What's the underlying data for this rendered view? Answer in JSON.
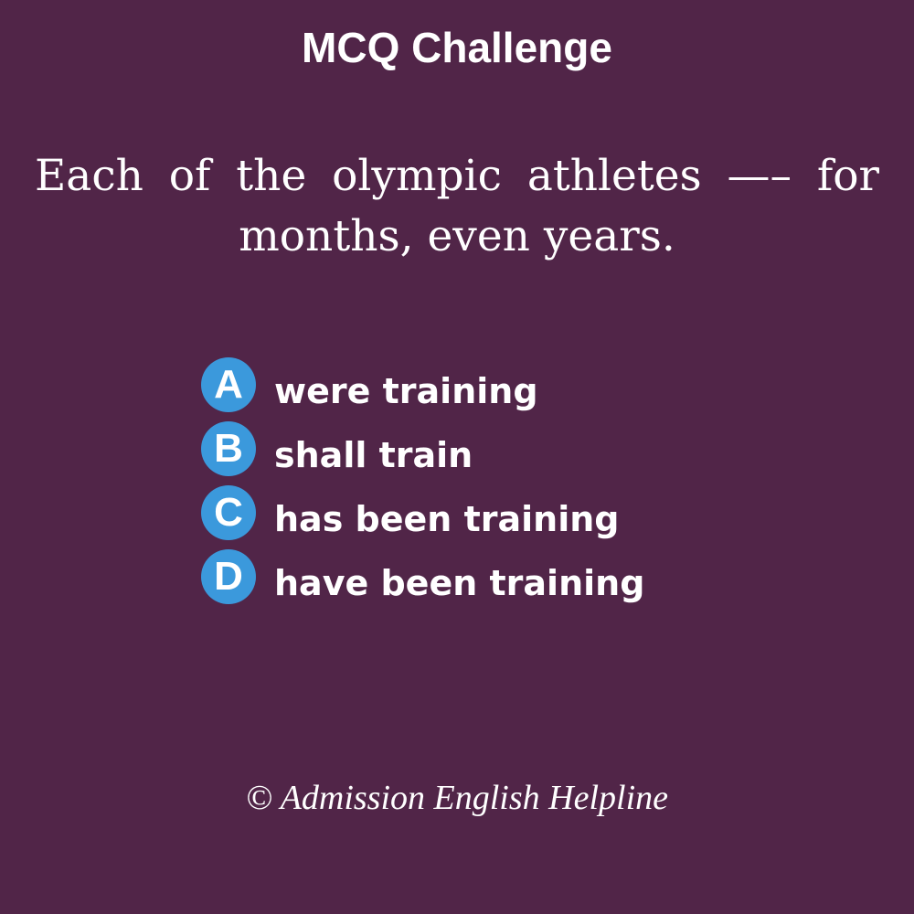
{
  "title": "MCQ Challenge",
  "question": "Each of the olympic athletes —– for months, even years.",
  "options": [
    {
      "letter": "A",
      "text": "were training"
    },
    {
      "letter": "B",
      "text": "shall train"
    },
    {
      "letter": "C",
      "text": "has been training"
    },
    {
      "letter": "D",
      "text": "have been training"
    }
  ],
  "footer": "© Admission English Helpline",
  "colors": {
    "background": "#512548",
    "badge": "#3b99dc",
    "text": "#ffffff"
  }
}
